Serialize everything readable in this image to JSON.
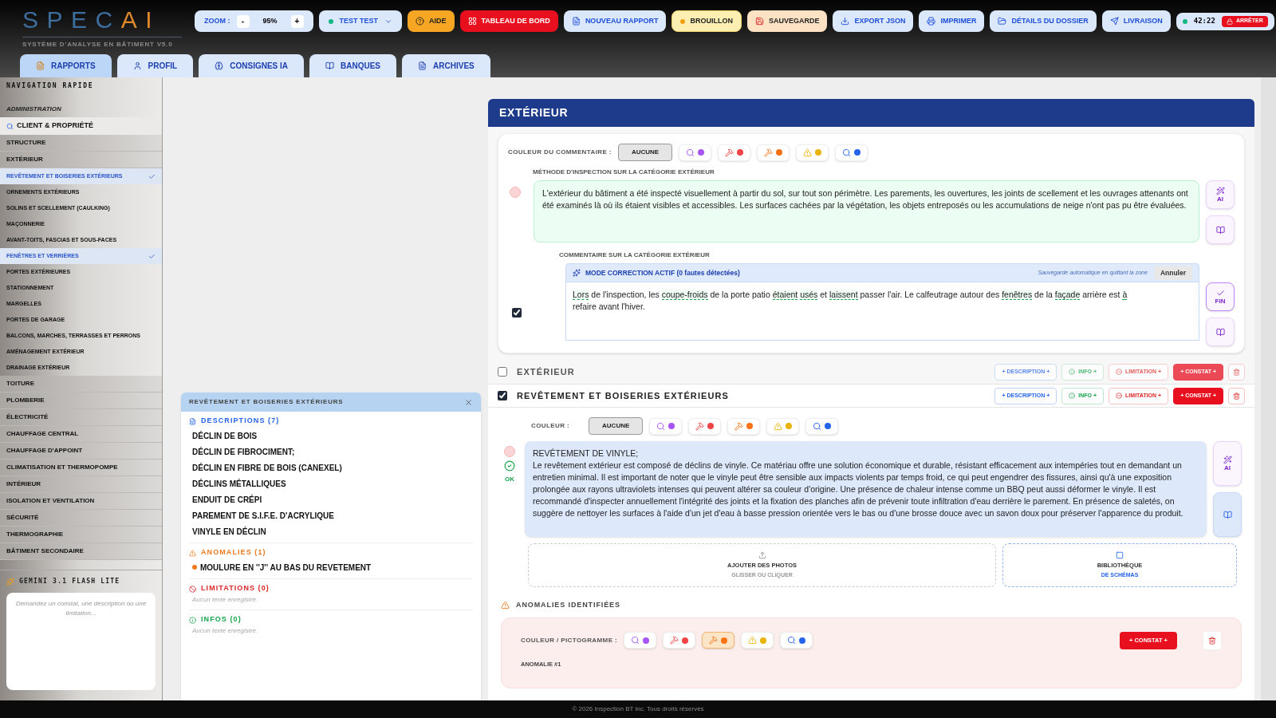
{
  "app": {
    "logo_main": "SPEC",
    "logo_accent": "AI",
    "subtitle": "SYSTÈME D'ANALYSE EN BÂTIMENT V5.0"
  },
  "toolbar": {
    "zoom": {
      "label": "ZOOM :",
      "minus": "-",
      "value": "95%",
      "plus": "+"
    },
    "user": {
      "label": "TEST TEST"
    },
    "buttons": [
      {
        "kind": "help",
        "label": "AIDE"
      },
      {
        "kind": "danger",
        "label": "TABLEAU DE BORD"
      },
      {
        "kind": "default",
        "label": "NOUVEAU RAPPORT"
      },
      {
        "kind": "draft",
        "label": "BROUILLON"
      },
      {
        "kind": "save",
        "label": "SAUVEGARDE"
      },
      {
        "kind": "default",
        "label": "EXPORT JSON"
      },
      {
        "kind": "default",
        "label": "IMPRIMER"
      },
      {
        "kind": "default",
        "label": "DÉTAILS DU DOSSIER"
      },
      {
        "kind": "default",
        "label": "LIVRAISON"
      }
    ],
    "timer": {
      "time": "42:22",
      "stop": "ARRÊTER"
    }
  },
  "tabs": [
    {
      "label": "RAPPORTS",
      "selected": true
    },
    {
      "label": "PROFIL",
      "selected": false
    },
    {
      "label": "CONSIGNES IA",
      "selected": false
    },
    {
      "label": "BANQUES",
      "selected": false
    },
    {
      "label": "ARCHIVES",
      "selected": false
    }
  ],
  "sidebar": {
    "heading": "NAVIGATION RAPIDE",
    "admin_label": "ADMINISTRATION",
    "client_item": {
      "label": "CLIENT & PROPRIÉTÉ",
      "selected": true
    },
    "categories": [
      {
        "label": "STRUCTURE"
      },
      {
        "label": "EXTÉRIEUR",
        "children": [
          {
            "label": "REVÊTEMENT ET BOISERIES EXTÉRIEURS",
            "checked": true
          },
          {
            "label": "ORNEMENTS EXTÉRIEURS",
            "checked": false
          },
          {
            "label": "SOLINS ET SCELLEMENT (CAULKING)",
            "checked": false
          },
          {
            "label": "MAÇONNERIE",
            "checked": false
          },
          {
            "label": "AVANT-TOITS, FASCIAS ET SOUS-FACES",
            "checked": false
          },
          {
            "label": "FENÊTRES ET VERRIÈRES",
            "checked": true
          },
          {
            "label": "PORTES EXTÉRIEURES",
            "checked": false
          },
          {
            "label": "STATIONNEMENT",
            "checked": false
          },
          {
            "label": "MARGELLES",
            "checked": false
          },
          {
            "label": "PORTES DE GARAGE",
            "checked": false
          },
          {
            "label": "BALCONS, MARCHES, TERRASSES ET PERRONS",
            "checked": false
          },
          {
            "label": "AMÉNAGEMENT EXTÉRIEUR",
            "checked": false
          },
          {
            "label": "DRAINAGE EXTÉRIEUR",
            "checked": false
          }
        ]
      },
      {
        "label": "TOITURE"
      },
      {
        "label": "PLOMBERIE"
      },
      {
        "label": "ÉLECTRICITÉ"
      },
      {
        "label": "CHAUFFAGE CENTRAL"
      },
      {
        "label": "CHAUFFAGE D'APPOINT"
      },
      {
        "label": "CLIMATISATION ET THERMOPOMPE"
      },
      {
        "label": "INTÉRIEUR"
      },
      {
        "label": "ISOLATION ET VENTILATION"
      },
      {
        "label": "SÉCURITÉ"
      },
      {
        "label": "THERMOGRAPHIE"
      },
      {
        "label": "BÂTIMENT SECONDAIRE"
      }
    ],
    "assistant": {
      "title": "GEMINI 3.1 FLASH LITE",
      "placeholder": "Demandez un constat, une description ou une limitation..."
    }
  },
  "library_panel": {
    "title": "REVÊTEMENT ET BOISERIES EXTÉRIEURS",
    "sections": [
      {
        "kind": "descriptions",
        "title": "DESCRIPTIONS (7)",
        "items": [
          "DÉCLIN DE BOIS",
          "DÉCLIN DE FIBROCIMENT;",
          "DÉCLIN EN FIBRE DE BOIS (CANEXEL)",
          "DÉCLINS MÉTALLIQUES",
          "ENDUIT DE CRÉPI",
          "PAREMENT DE S.I.F.E. D'ACRYLIQUE",
          "VINYLE EN DÉCLIN"
        ]
      },
      {
        "kind": "anomalies",
        "title": "ANOMALIES (1)",
        "items": [
          "MOULURE EN ''J'' AU BAS DU REVETEMENT"
        ]
      },
      {
        "kind": "limitations",
        "title": "LIMITATIONS (0)",
        "empty": "Aucun texte enregistré."
      },
      {
        "kind": "infos",
        "title": "INFOS (0)",
        "empty": "Aucun texte enregistré."
      }
    ]
  },
  "main": {
    "title": "EXTÉRIEUR",
    "comment_card": {
      "color_picker": {
        "label": "COULEUR DU COMMENTAIRE :",
        "none": {
          "label": "AUCUNE",
          "selected": true
        },
        "options": [
          {
            "color": "#a855f7",
            "selected": false
          },
          {
            "color": "#ef4444",
            "selected": false
          },
          {
            "color": "#f97316",
            "selected": false
          },
          {
            "color": "#eab308",
            "selected": false
          },
          {
            "color": "#2563eb",
            "selected": false
          }
        ]
      },
      "method_label": "MÉTHODE D'INSPECTION SUR LA CATÉGORIE EXTÉRIEUR",
      "method_text": "L'extérieur du bâtiment a été inspecté visuellement à partir du sol, sur tout son périmètre. Les parements, les ouvertures, les joints de scellement et les ouvrages attenants ont été examinés là où ils étaient visibles et accessibles. Les surfaces cachées par la végétation, les objets entreposés ou les accumulations de neige n'ont pas pu être évaluées.",
      "ai_label": "AI",
      "comment_label": "COMMENTAIRE SUR LA CATÉGORIE EXTÉRIEUR",
      "correction": {
        "title": "MODE CORRECTION ACTIF (0 fautes détectées)",
        "autosave": "Sauvegarde automatique en quittant la zone",
        "cancel": "Annuler"
      },
      "checked": true,
      "segments": [
        {
          "text": "Lors",
          "flagged": true
        },
        {
          "text": "de l'inspection, les",
          "flagged": false
        },
        {
          "text": "coupe-froids",
          "flagged": true
        },
        {
          "text": "de la porte patio",
          "flagged": false
        },
        {
          "text": "étaient",
          "flagged": true
        },
        {
          "text": "usés",
          "flagged": true
        },
        {
          "text": "et",
          "flagged": false
        },
        {
          "text": "laissent",
          "flagged": true
        },
        {
          "text": "passer l'air. Le calfeutrage autour des",
          "flagged": false
        },
        {
          "text": "fenêtres",
          "flagged": true
        },
        {
          "text": "de la",
          "flagged": false
        },
        {
          "text": "façade",
          "flagged": true
        },
        {
          "text": "arrière est",
          "flagged": false
        },
        {
          "text": "à",
          "flagged": true
        },
        {
          "text": "refaire avant l'hiver.",
          "flagged": false
        }
      ],
      "done_label": "FIN"
    },
    "sections": [
      {
        "title": "EXTÉRIEUR",
        "checked": false,
        "buttons": [
          {
            "kind": "description",
            "label": "+ DESCRIPTION +"
          },
          {
            "kind": "info",
            "label": "INFO +"
          },
          {
            "kind": "limitation",
            "label": "LIMITATION +"
          },
          {
            "kind": "constat",
            "label": "+ CONSTAT +"
          }
        ]
      },
      {
        "title": "REVÊTEMENT ET BOISERIES EXTÉRIEURS",
        "checked": true,
        "buttons": [
          {
            "kind": "description",
            "label": "+ DESCRIPTION +"
          },
          {
            "kind": "info",
            "label": "INFO +"
          },
          {
            "kind": "limitation",
            "label": "LIMITATION +"
          },
          {
            "kind": "constat",
            "label": "+ CONSTAT +"
          }
        ]
      }
    ],
    "detail": {
      "color_picker": {
        "label": "COULEUR :",
        "none": {
          "label": "AUCUNE",
          "selected": true
        },
        "options": [
          {
            "color": "#a855f7",
            "selected": false
          },
          {
            "color": "#ef4444",
            "selected": false
          },
          {
            "color": "#f97316",
            "selected": false
          },
          {
            "color": "#eab308",
            "selected": false
          },
          {
            "color": "#2563eb",
            "selected": false
          }
        ]
      },
      "description_title": "REVÊTEMENT DE VINYLE;",
      "description_text": "Le revêtement extérieur est composé de déclins de vinyle. Ce matériau offre une solution économique et durable, résistant efficacement aux intempéries tout en demandant un entretien minimal. Il est important de noter que le vinyle peut être sensible aux impacts violents par temps froid, ce qui peut engendrer des fissures, ainsi qu'à une exposition prolongée aux rayons ultraviolets intenses qui peuvent altérer sa couleur d'origine. Une présence de chaleur intense comme un BBQ peut aussi déformer le vinyle. Il est recommandé d'inspecter annuellement l'intégrité des joints et la fixation des planches afin de prévenir toute infiltration d'eau derrière le parement. En présence de saletés, on suggère de nettoyer les surfaces à l'aide d'un jet d'eau à basse pression orientée vers le bas ou d'une brosse douce avec un savon doux pour préserver l'apparence du produit.",
      "ok_label": "OK",
      "ai_label": "AI",
      "photos": {
        "title": "AJOUTER DES PHOTOS",
        "hint": "GLISSER OU CLIQUER"
      },
      "schemas": {
        "title": "BIBLIOTHÈQUE",
        "subtitle": "DE SCHÉMAS"
      },
      "anomalies_title": "ANOMALIES IDENTIFIÉES",
      "anomaly": {
        "color_picker": {
          "label": "COULEUR / PICTOGRAMME :",
          "options": [
            {
              "color": "#a855f7",
              "selected": false
            },
            {
              "color": "#ef4444",
              "selected": false
            },
            {
              "color": "#f97316",
              "selected": true
            },
            {
              "color": "#eab308",
              "selected": false
            },
            {
              "color": "#2563eb",
              "selected": false
            }
          ]
        },
        "constat": "+ CONSTAT +",
        "label": "ANOMALIE #1"
      }
    }
  },
  "footer": "© 2026 Inspection BT inc. Tous droits réservés"
}
